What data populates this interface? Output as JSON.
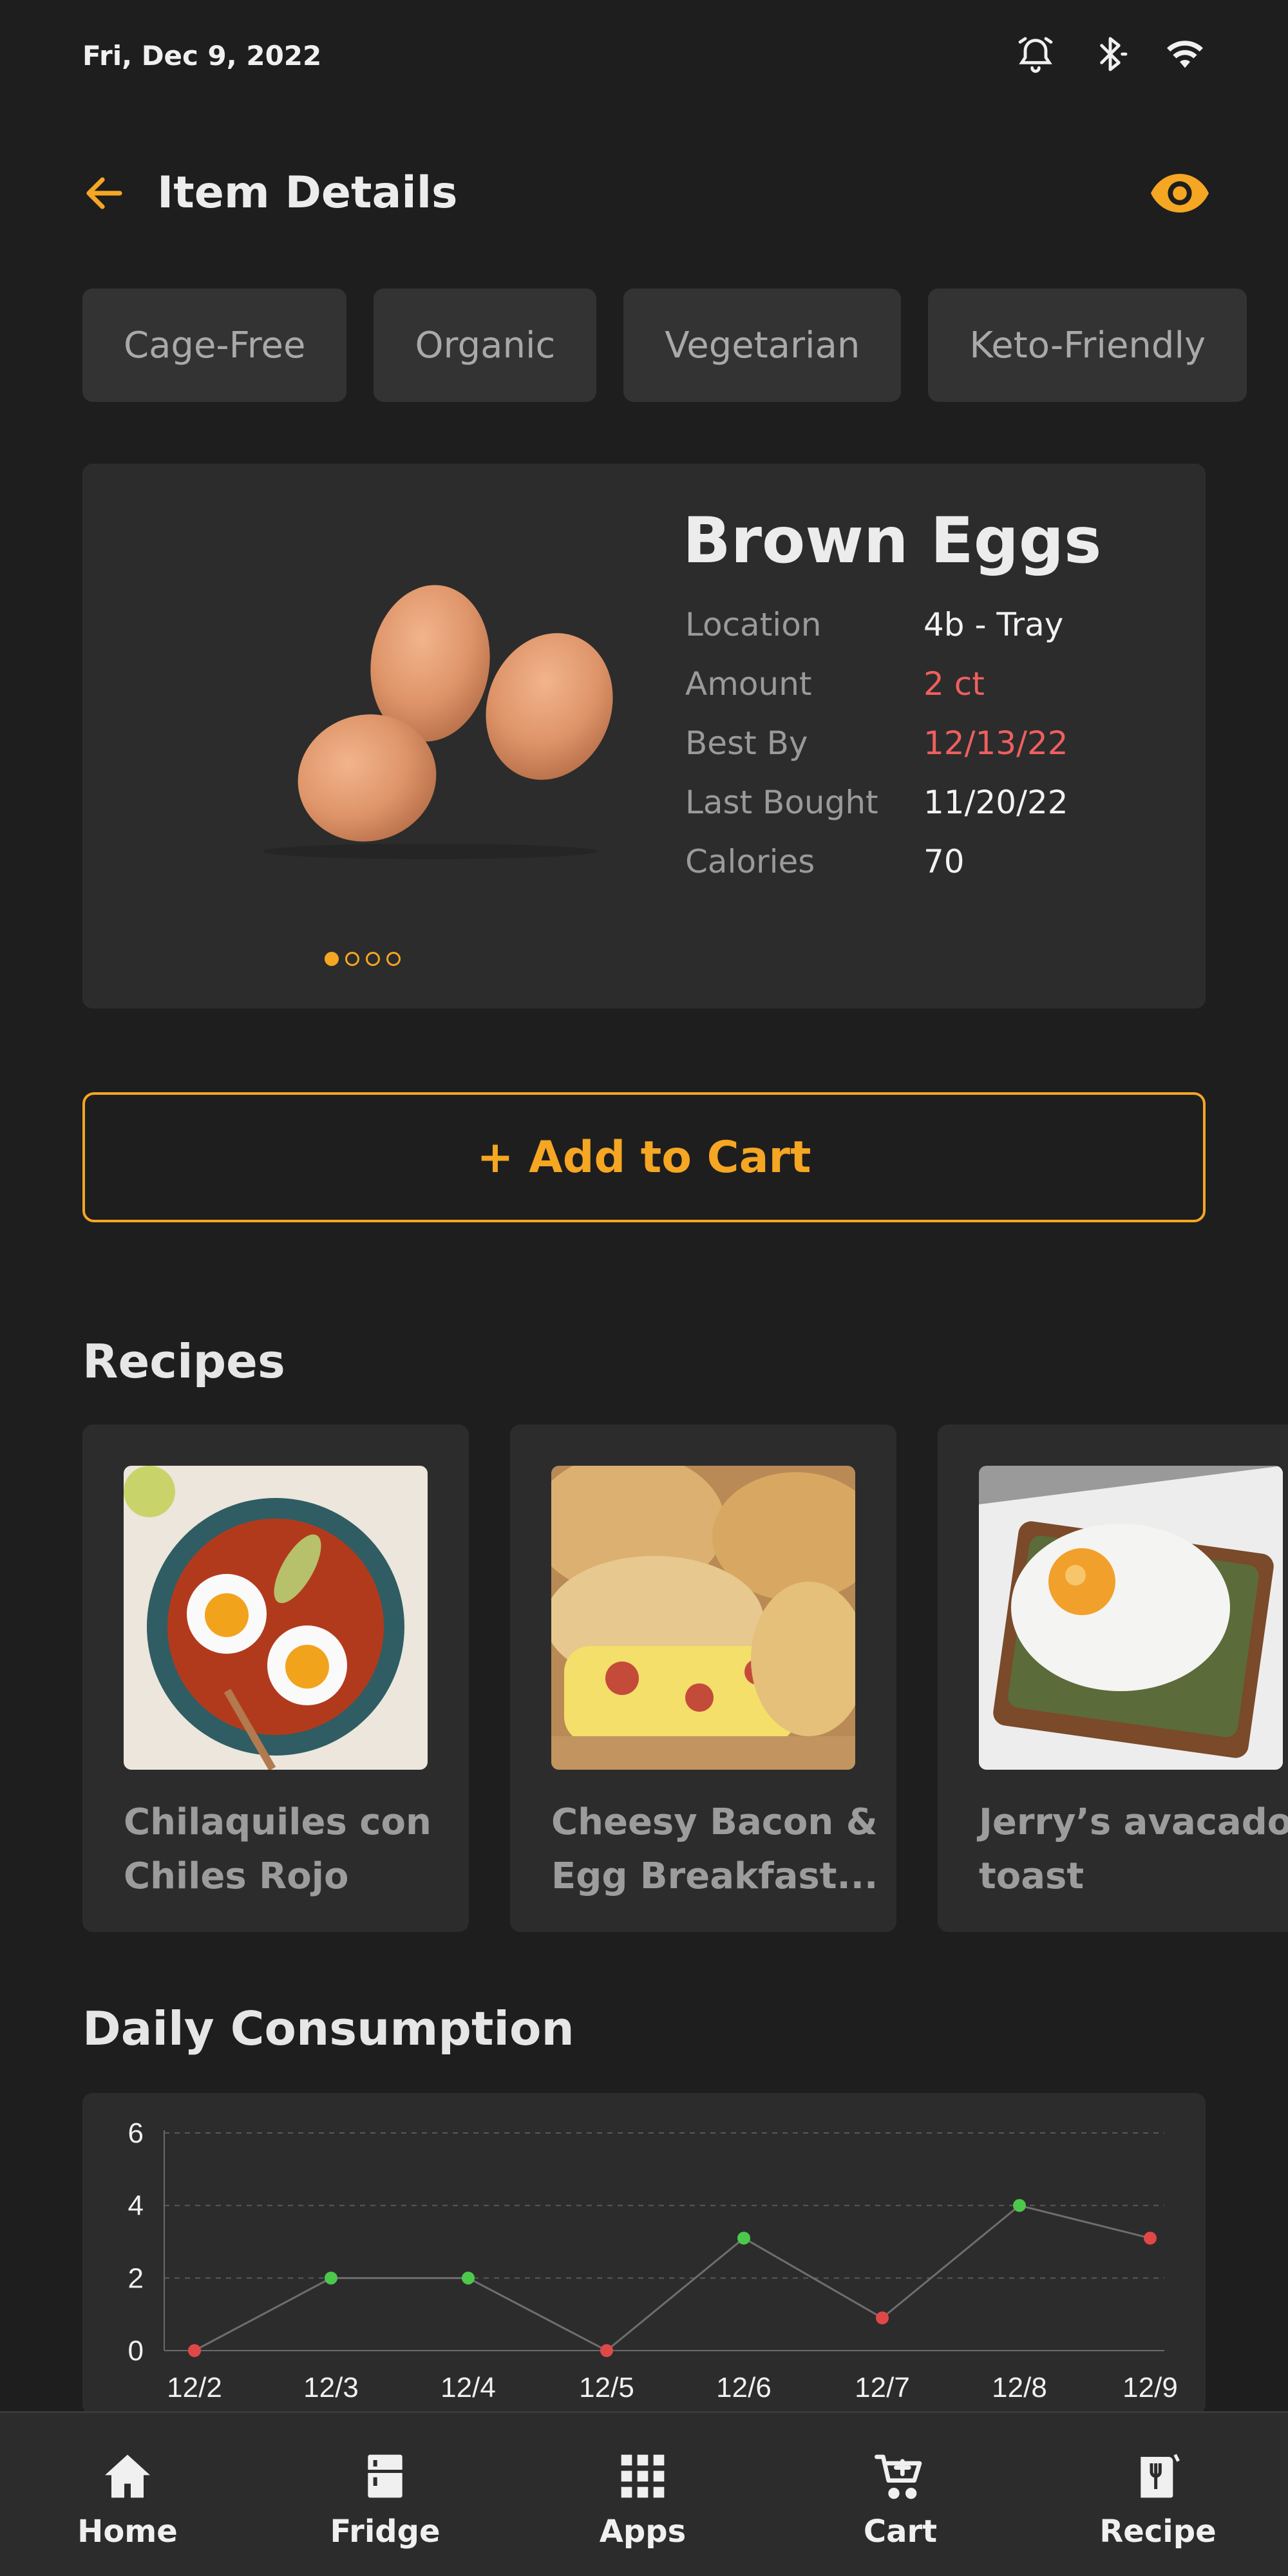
{
  "status_bar": {
    "date": "Fri, Dec 9, 2022",
    "icons": [
      "alarm-icon",
      "bluetooth-icon",
      "wifi-icon"
    ]
  },
  "header": {
    "title": "Item Details",
    "back_icon": "arrow-left-icon",
    "visibility_icon": "eye-icon",
    "accent_color": "#f5a623"
  },
  "tags": [
    "Cage-Free",
    "Organic",
    "Vegetarian",
    "Keto-Friendly"
  ],
  "product": {
    "name": "Brown Eggs",
    "image_count": 4,
    "active_image": 0,
    "details": [
      {
        "label": "Location",
        "value": "4b - Tray",
        "alert": false
      },
      {
        "label": "Amount",
        "value": "2 ct",
        "alert": true
      },
      {
        "label": "Best By",
        "value": "12/13/22",
        "alert": true
      },
      {
        "label": "Last Bought",
        "value": "11/20/22",
        "alert": false
      },
      {
        "label": "Calories",
        "value": "70",
        "alert": false
      }
    ],
    "alert_color": "#ef5f5f"
  },
  "add_to_cart_label": "+ Add to Cart",
  "recipes": {
    "title": "Recipes",
    "items": [
      {
        "name": "Chilaquiles con Chiles Rojo"
      },
      {
        "name": "Cheesy Bacon & Egg Breakfast..."
      },
      {
        "name": "Jerry’s avacado toast"
      }
    ]
  },
  "consumption": {
    "title": "Daily Consumption"
  },
  "chart_data": {
    "type": "line",
    "title": "",
    "xlabel": "",
    "ylabel": "",
    "categories": [
      "12/2",
      "12/3",
      "12/4",
      "12/5",
      "12/6",
      "12/7",
      "12/8",
      "12/9"
    ],
    "values": [
      0,
      2,
      2,
      0,
      3.1,
      0.9,
      4,
      3.1
    ],
    "point_colors": [
      "#e04848",
      "#4cc84c",
      "#4cc84c",
      "#e04848",
      "#4cc84c",
      "#e04848",
      "#4cc84c",
      "#e04848"
    ],
    "yticks": [
      0,
      2,
      4,
      6
    ],
    "ylim": [
      0,
      6
    ],
    "grid": true
  },
  "bottom_nav": [
    {
      "label": "Home",
      "icon": "home-icon"
    },
    {
      "label": "Fridge",
      "icon": "fridge-icon"
    },
    {
      "label": "Apps",
      "icon": "apps-grid-icon"
    },
    {
      "label": "Cart",
      "icon": "cart-icon"
    },
    {
      "label": "Recipe",
      "icon": "recipe-book-icon"
    }
  ]
}
